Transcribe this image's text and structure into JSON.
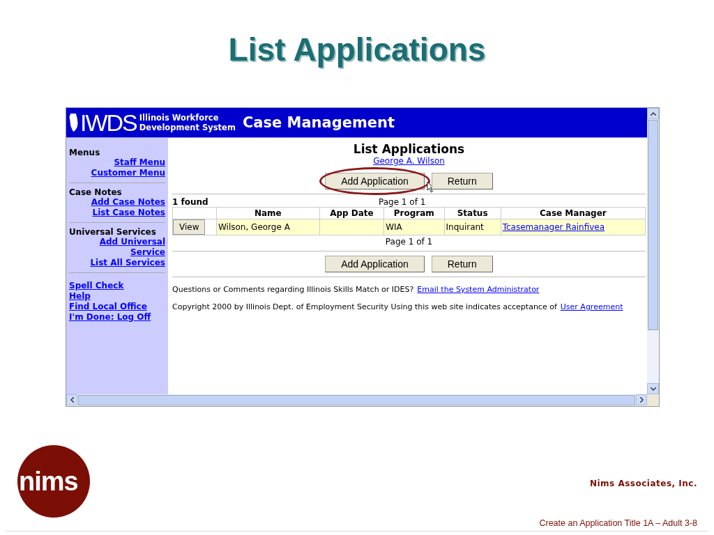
{
  "slide_title": "List Applications",
  "app": {
    "banner": {
      "logo": "IWDS",
      "org_line_1": "Illinois Workforce",
      "org_line_2": "Development System",
      "title": "Case Management"
    },
    "sidebar": {
      "sections": [
        {
          "heading": "Menus",
          "links": [
            "Staff Menu",
            "Customer Menu"
          ]
        },
        {
          "heading": "Case Notes",
          "links": [
            "Add Case Notes",
            "List Case Notes"
          ]
        },
        {
          "heading": "Universal Services",
          "links": [
            "Add Universal Service",
            "List All Services"
          ]
        }
      ],
      "links": [
        "Spell Check",
        "Help",
        "Find Local Office",
        "I'm Done: Log Off"
      ]
    },
    "page": {
      "heading": "List Applications",
      "client_link": "George A. Wilson",
      "buttons_top": [
        {
          "label": "Add Application",
          "highlighted": true
        },
        {
          "label": "Return",
          "highlighted": false
        }
      ],
      "found": "1  found",
      "pager_top": "Page 1 of 1",
      "columns": [
        "Name",
        "App Date",
        "Program",
        "Status",
        "Case Manager"
      ],
      "rows": [
        {
          "action": "View",
          "name": "Wilson, George A",
          "program": "WIA",
          "status": "Inquirant",
          "case_manager": "Tcasemanager Rainfivea"
        }
      ],
      "pager_bottom": "Page 1 of 1",
      "buttons_bottom": [
        {
          "label": "Add Application",
          "highlighted": false
        },
        {
          "label": "Return",
          "highlighted": false
        }
      ],
      "questions": "Questions or Comments regarding Illinois Skills Match or IDES?",
      "email_link": "Email the System Administrator",
      "copyright": "Copyright 2000 by Illinois Dept. of Employment Security Using this web site indicates acceptance of",
      "agreement_link": "User Agreement"
    }
  },
  "logo": "nims",
  "company": "Nims Associates, Inc.",
  "footer": "Create an Application Title 1A – Adult 3-8"
}
